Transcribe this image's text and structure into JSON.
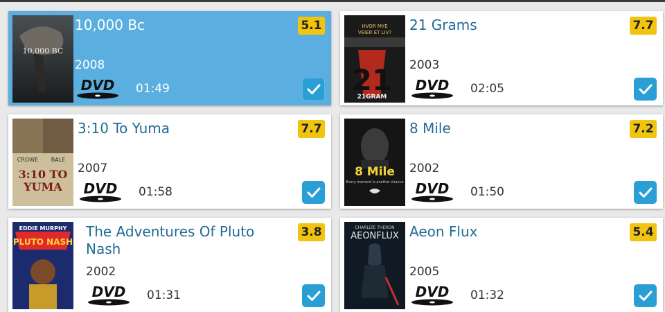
{
  "movies": [
    {
      "title": "10,000 Bc",
      "year": "2008",
      "runtime": "01:49",
      "rating": "5.1",
      "format_icon": "dvd-logo",
      "checked": true,
      "selected": true
    },
    {
      "title": "21 Grams",
      "year": "2003",
      "runtime": "02:05",
      "rating": "7.7",
      "format_icon": "dvd-logo",
      "checked": true,
      "selected": false
    },
    {
      "title": "3:10 To Yuma",
      "year": "2007",
      "runtime": "01:58",
      "rating": "7.7",
      "format_icon": "dvd-logo",
      "checked": true,
      "selected": false
    },
    {
      "title": "8 Mile",
      "year": "2002",
      "runtime": "01:50",
      "rating": "7.2",
      "format_icon": "dvd-logo",
      "checked": true,
      "selected": false
    },
    {
      "title": "The Adventures Of Pluto Nash",
      "year": "2002",
      "runtime": "01:31",
      "rating": "3.8",
      "format_icon": "dvd-logo",
      "checked": true,
      "selected": false
    },
    {
      "title": "Aeon Flux",
      "year": "2005",
      "runtime": "01:32",
      "rating": "5.4",
      "format_icon": "dvd-logo",
      "checked": true,
      "selected": false
    }
  ],
  "colors": {
    "selected_card": "#5aafe0",
    "title_link": "#1f6b94",
    "rating_badge": "#f1c40f",
    "checkbox": "#2a9fd6"
  }
}
